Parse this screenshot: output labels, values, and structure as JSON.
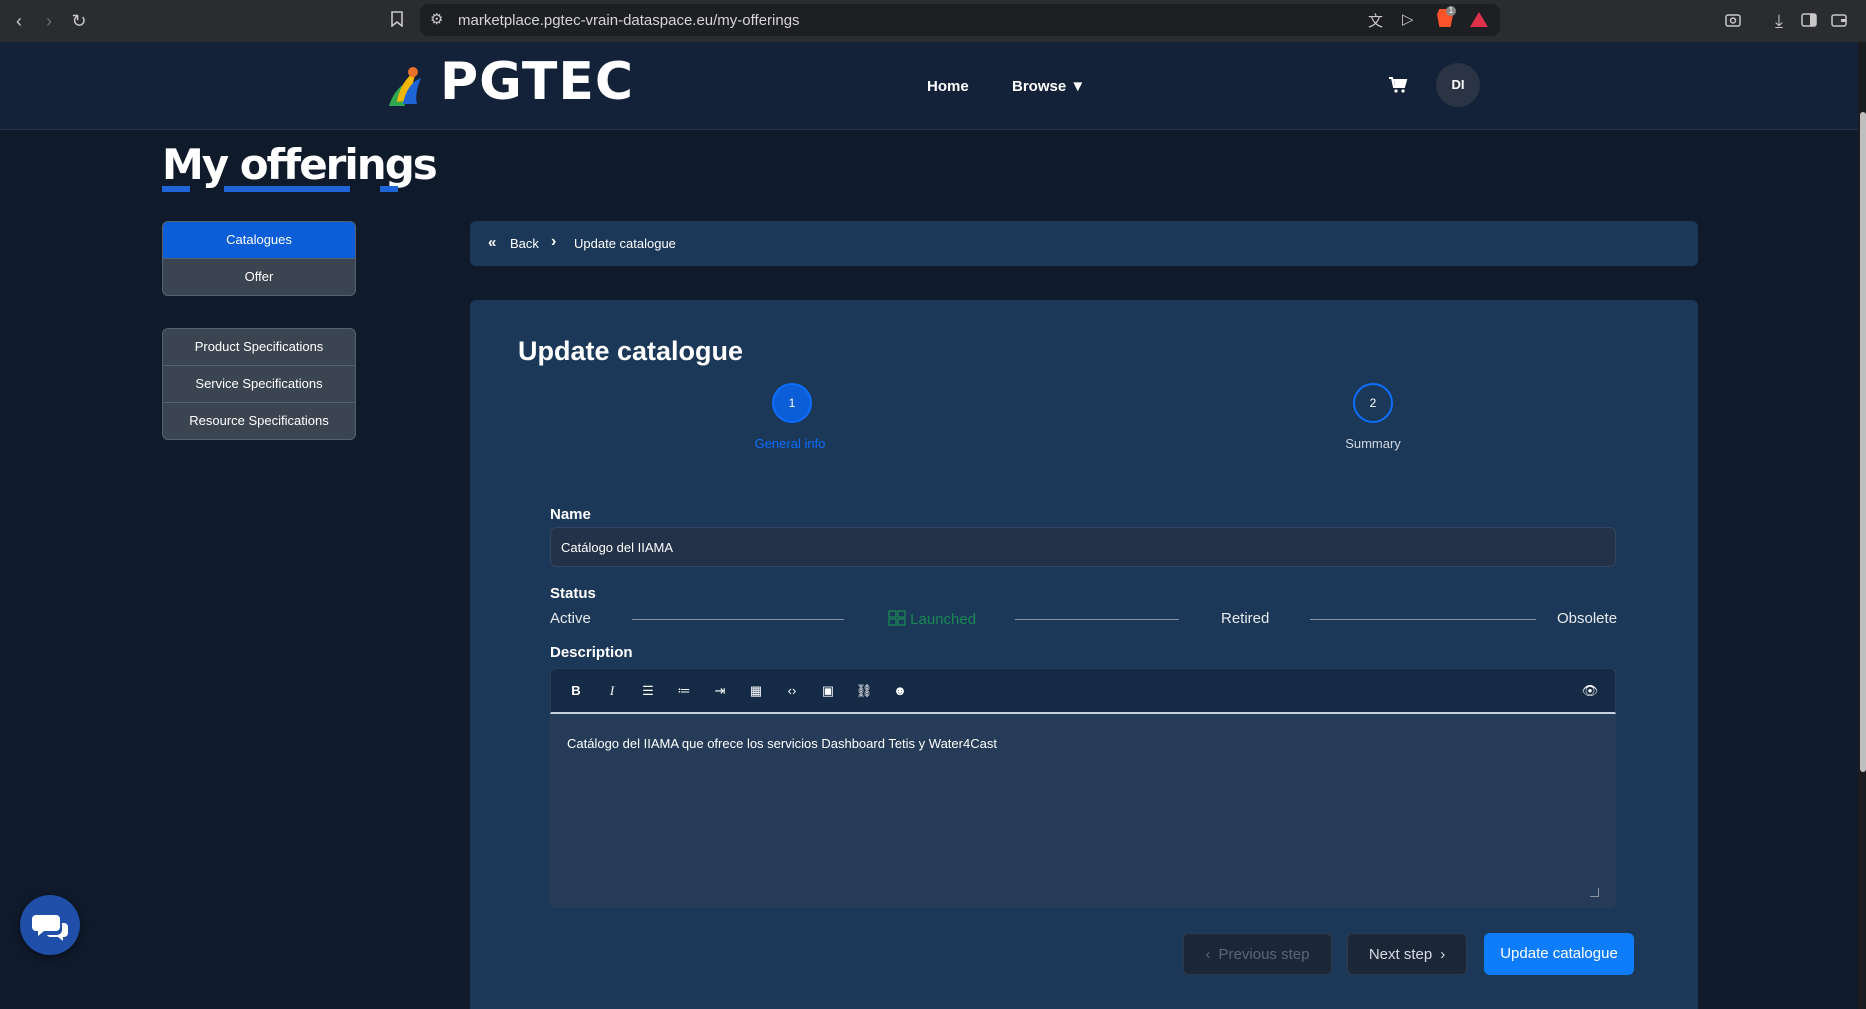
{
  "browser": {
    "url": "marketplace.pgtec-vrain-dataspace.eu/my-offerings",
    "brave_badge": "1"
  },
  "header": {
    "logo_text": "PGTEC",
    "nav": {
      "home": "Home",
      "browse": "Browse ▼"
    },
    "cart_icon": "cart-icon",
    "avatar_initials": "DI"
  },
  "page": {
    "title": "My offerings"
  },
  "sidebar": {
    "tabs": [
      {
        "label": "Catalogues",
        "active": true
      },
      {
        "label": "Offer",
        "active": false
      }
    ],
    "specs": [
      {
        "label": "Product Specifications"
      },
      {
        "label": "Service Specifications"
      },
      {
        "label": "Resource Specifications"
      }
    ]
  },
  "breadcrumb": {
    "back": "Back",
    "current": "Update catalogue"
  },
  "form": {
    "title": "Update catalogue",
    "steps": [
      {
        "number": "1",
        "label": "General info",
        "active": true
      },
      {
        "number": "2",
        "label": "Summary",
        "active": false
      }
    ],
    "name_label": "Name",
    "name_value": "Catálogo del IIAMA",
    "status_label": "Status",
    "status_options": [
      {
        "label": "Active",
        "selected": false
      },
      {
        "label": "Launched",
        "selected": true
      },
      {
        "label": "Retired",
        "selected": false
      },
      {
        "label": "Obsolete",
        "selected": false
      }
    ],
    "description_label": "Description",
    "toolbar_icons": [
      "bold-icon",
      "italic-icon",
      "bullet-list-icon",
      "numbered-list-icon",
      "indent-icon",
      "table-icon",
      "code-icon",
      "media-icon",
      "link-icon",
      "emoji-icon",
      "preview-icon"
    ],
    "description_text": "Catálogo del IIAMA que ofrece los servicios Dashboard Tetis y Water4Cast",
    "buttons": {
      "previous": "Previous step",
      "next": "Next step",
      "update": "Update catalogue"
    }
  },
  "colors": {
    "accent": "#0d7dfc",
    "active_tab": "#0b5ed7",
    "launched": "#198754",
    "panel": "#1c3858"
  }
}
